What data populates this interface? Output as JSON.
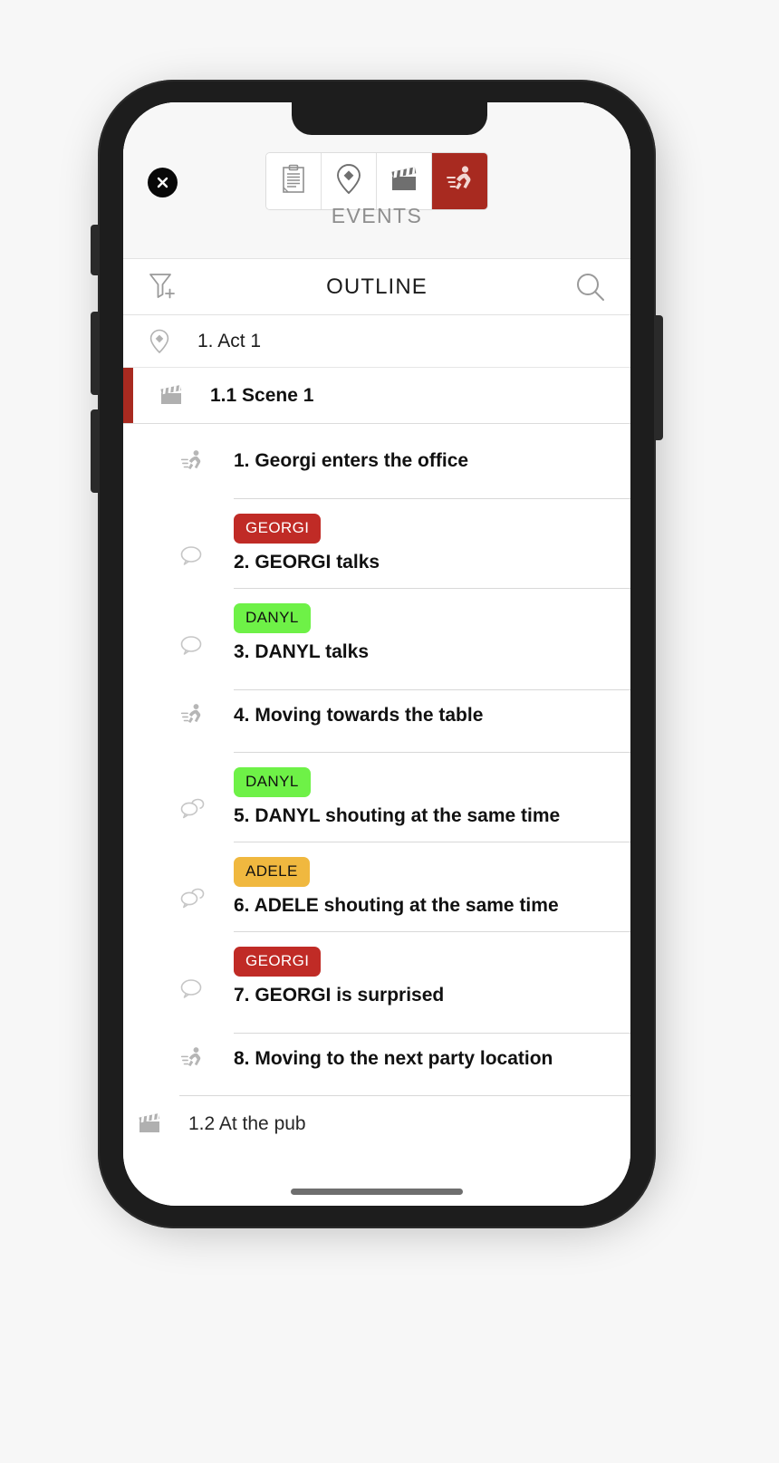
{
  "app": {
    "close_button_label": "close",
    "section_label": "EVENTS"
  },
  "segmented_control": {
    "items": [
      {
        "icon": "clipboard-icon",
        "label": "Script",
        "active": false
      },
      {
        "icon": "location-pin-icon",
        "label": "Locations",
        "active": false
      },
      {
        "icon": "clapperboard-icon",
        "label": "Scenes",
        "active": false
      },
      {
        "icon": "running-person-icon",
        "label": "Events",
        "active": true
      }
    ],
    "active_index": 3,
    "active_color": "#a82a20"
  },
  "outline_header": {
    "title": "OUTLINE",
    "filter_icon": "filter-funnel-add-icon",
    "search_icon": "search-icon"
  },
  "outline": {
    "act": {
      "icon": "location-pin-icon",
      "label": "1. Act 1"
    },
    "scene": {
      "icon": "clapperboard-icon",
      "label": "1.1 Scene 1",
      "accent_color": "#a82a20",
      "selected": true
    },
    "next_scene": {
      "icon": "clapperboard-icon",
      "label": "1.2 At the pub",
      "selected": false
    },
    "events": [
      {
        "icon": "running-person-icon",
        "title": "1. Georgi enters the office",
        "tag": null
      },
      {
        "icon": "speech-bubble-icon",
        "title": "2. GEORGI talks",
        "tag": {
          "name": "GEORGI",
          "bg": "#c02b26",
          "fg": "#ffffff"
        }
      },
      {
        "icon": "speech-bubble-icon",
        "title": "3. DANYL talks",
        "tag": {
          "name": "DANYL",
          "bg": "#6ef147",
          "fg": "#111111"
        }
      },
      {
        "icon": "running-person-icon",
        "title": "4. Moving towards the table",
        "tag": null
      },
      {
        "icon": "double-speech-bubble-icon",
        "title": "5. DANYL shouting at the same time",
        "tag": {
          "name": "DANYL",
          "bg": "#6ef147",
          "fg": "#111111"
        }
      },
      {
        "icon": "double-speech-bubble-icon",
        "title": "6. ADELE shouting at the same time",
        "tag": {
          "name": "ADELE",
          "bg": "#f0b83f",
          "fg": "#111111"
        }
      },
      {
        "icon": "speech-bubble-icon",
        "title": "7. GEORGI is surprised",
        "tag": {
          "name": "GEORGI",
          "bg": "#c02b26",
          "fg": "#ffffff"
        }
      },
      {
        "icon": "running-person-icon",
        "title": "8. Moving to the next party location",
        "tag": null
      }
    ]
  },
  "device": {
    "home_indicator": "home-indicator"
  }
}
